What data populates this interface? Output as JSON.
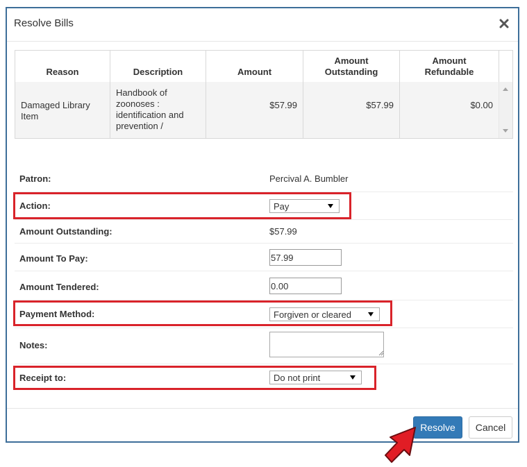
{
  "dialog": {
    "title": "Resolve Bills"
  },
  "bills_table": {
    "columns": [
      "Reason",
      "Description",
      "Amount",
      "Amount Outstanding",
      "Amount Refundable"
    ],
    "rows": [
      {
        "reason": "Damaged Library Item",
        "description": "Handbook of zoonoses : identification and prevention /",
        "amount": "$57.99",
        "amount_outstanding": "$57.99",
        "amount_refundable": "$0.00"
      }
    ]
  },
  "form": {
    "patron_label": "Patron:",
    "patron_value": "Percival A. Bumbler",
    "action_label": "Action:",
    "action_value": "Pay",
    "amount_outstanding_label": "Amount Outstanding:",
    "amount_outstanding_value": "$57.99",
    "amount_to_pay_label": "Amount To Pay:",
    "amount_to_pay_value": "57.99",
    "amount_tendered_label": "Amount Tendered:",
    "amount_tendered_value": "0.00",
    "payment_method_label": "Payment Method:",
    "payment_method_value": "Forgiven or cleared",
    "notes_label": "Notes:",
    "notes_value": "",
    "receipt_to_label": "Receipt to:",
    "receipt_to_value": "Do not print"
  },
  "footer": {
    "resolve_label": "Resolve",
    "cancel_label": "Cancel"
  },
  "colors": {
    "highlight": "#d9232a",
    "primary_button": "#337ab7",
    "modal_border": "#3d6e99"
  }
}
